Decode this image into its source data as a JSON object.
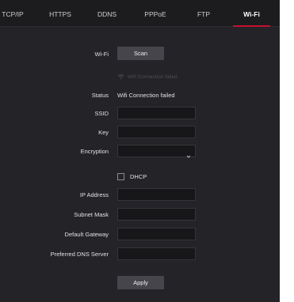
{
  "tabs": [
    {
      "label": "TCP/IP",
      "active": false
    },
    {
      "label": "HTTPS",
      "active": false
    },
    {
      "label": "DDNS",
      "active": false
    },
    {
      "label": "PPPoE",
      "active": false
    },
    {
      "label": "FTP",
      "active": false
    },
    {
      "label": "Wi-Fi",
      "active": true
    }
  ],
  "wifi": {
    "label": "Wi-Fi",
    "scan_label": "Scan",
    "connection_hint": "Wifi Connection failed",
    "status_label": "Status",
    "status_value": "Wifi Connection failed"
  },
  "fields": {
    "ssid_label": "SSID",
    "ssid_value": "",
    "key_label": "Key",
    "key_value": "",
    "encryption_label": "Encryption",
    "encryption_value": "",
    "dhcp_label": "DHCP",
    "dhcp_checked": false,
    "ip_label": "IP Address",
    "ip_value": "",
    "subnet_label": "Subnet Mask",
    "subnet_value": "",
    "gateway_label": "Default Gateway",
    "gateway_value": "",
    "dns_label": "Preferred DNS Server",
    "dns_value": ""
  },
  "apply_label": "Apply",
  "icons": {
    "wifi_hint": "wifi-icon",
    "encryption_dropdown": "chevron-down-icon"
  },
  "colors": {
    "accent": "#c8102e",
    "background": "#1c1c1f",
    "content": "#232328",
    "button": "#45454b",
    "input": "#17171a"
  }
}
